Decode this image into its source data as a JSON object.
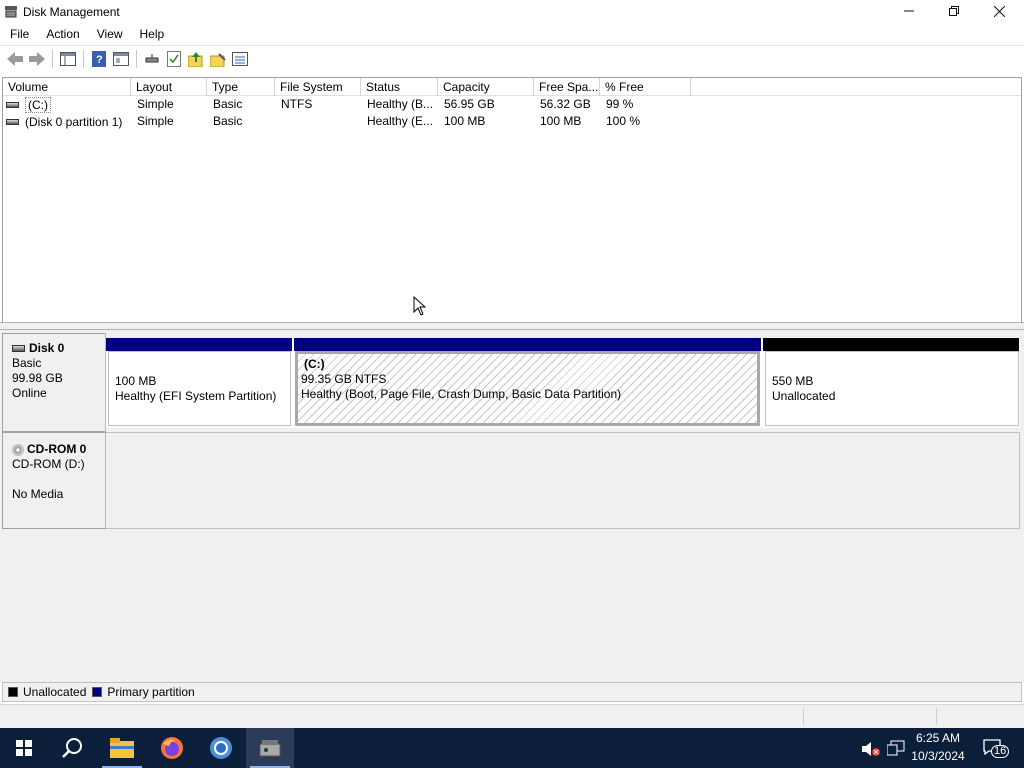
{
  "window": {
    "title": "Disk Management"
  },
  "menu": [
    "File",
    "Action",
    "View",
    "Help"
  ],
  "toolbar": {
    "icons": [
      "back-icon",
      "forward-icon",
      "console-tree-icon",
      "help-icon",
      "properties-icon",
      "connect-icon",
      "checklist-icon",
      "up-folder-icon",
      "folder-icon",
      "list-icon"
    ]
  },
  "volume_table": {
    "columns": [
      "Volume",
      "Layout",
      "Type",
      "File System",
      "Status",
      "Capacity",
      "Free Spa...",
      "% Free"
    ],
    "rows": [
      [
        "(C:)",
        "Simple",
        "Basic",
        "NTFS",
        "Healthy (B...",
        "56.95 GB",
        "56.32 GB",
        "99 %"
      ],
      [
        "(Disk 0 partition 1)",
        "Simple",
        "Basic",
        "",
        "Healthy (E...",
        "100 MB",
        "100 MB",
        "100 %"
      ]
    ]
  },
  "disks": {
    "disk0": {
      "name": "Disk 0",
      "type": "Basic",
      "size": "99.98 GB",
      "status": "Online",
      "partitions": [
        {
          "name": "",
          "size": "100 MB",
          "desc": "Healthy (EFI System Partition)",
          "color": "#000080"
        },
        {
          "name": "(C:)",
          "size": "99.35 GB NTFS",
          "desc": "Healthy (Boot, Page File, Crash Dump, Basic Data Partition)",
          "color": "#000080"
        },
        {
          "name": "",
          "size": "550 MB",
          "desc": "Unallocated",
          "color": "#000000"
        }
      ]
    },
    "cdrom0": {
      "name": "CD-ROM 0",
      "type": "CD-ROM (D:)",
      "status": "No Media"
    }
  },
  "legend": [
    {
      "label": "Unallocated",
      "color": "#000000"
    },
    {
      "label": "Primary partition",
      "color": "#000080"
    }
  ],
  "taskbar": {
    "apps": [
      "windows-start-icon",
      "search-icon",
      "file-explorer-icon",
      "firefox-icon",
      "chrome-icon",
      "disk-management-icon"
    ],
    "time": "6:25 AM",
    "date": "10/3/2024",
    "notification_count": "16"
  }
}
